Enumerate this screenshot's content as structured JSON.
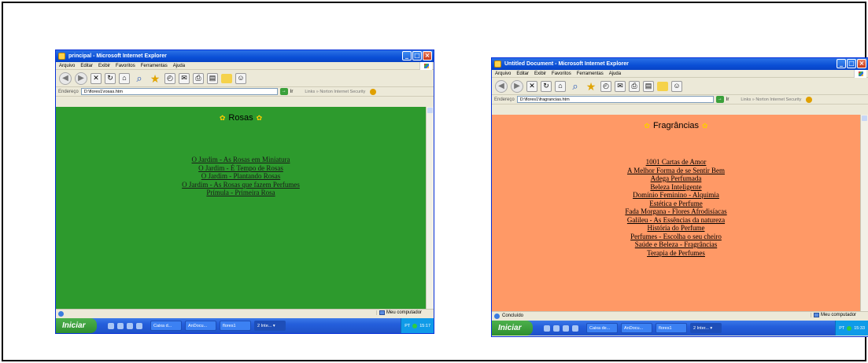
{
  "screens": [
    {
      "title": "principal - Microsoft Internet Explorer",
      "menu": [
        "Arquivo",
        "Editar",
        "Exibir",
        "Favoritos",
        "Ferramentas",
        "Ajuda"
      ],
      "address_label": "Endereço",
      "address": "D:\\flores1\\rosas.htm",
      "go_label": "Ir",
      "address_extra": "Links  »  Norton Internet Security",
      "heading": "Rosas",
      "links": [
        "O Jardim - As Rosas em Miniatura",
        "O Jardim - É Tempo de Rosas",
        "O Jardim - Plantando Rosas",
        "O Jardim - As Rosas que fazem Perfumes",
        "Prímula - Primeira Rosa"
      ],
      "status_left": "",
      "status_zone": "Meu computador",
      "taskbar": {
        "start": "Iniciar",
        "buttons": [
          "Caixa d...",
          "AnDocu...",
          "flores1",
          "2 Inte...  ▾"
        ],
        "clock": "15:17",
        "tray_lang": "PT"
      }
    },
    {
      "title": "Untitled Document - Microsoft Internet Explorer",
      "menu": [
        "Arquivo",
        "Editar",
        "Exibir",
        "Favoritos",
        "Ferramentas",
        "Ajuda"
      ],
      "address_label": "Endereço",
      "address": "D:\\flores1\\fragrancias.htm",
      "go_label": "Ir",
      "address_extra": "Links  »  Norton Internet Security",
      "heading": "Fragrâncias",
      "links": [
        "1001 Cartas de Amor",
        "A Melhor Forma de se Sentir Bem",
        "Adega Perfumada",
        "Beleza Inteligente",
        "Domínio Feminino - Alquimia",
        "Estética e Perfume",
        "Fada Morgana - Flores Afrodisíacas",
        "Galileu - As Essências da natureza",
        "História do Perfume",
        "Perfumes - Escolha o seu cheiro",
        "Saúde e Beleza - Fragrâncias",
        "Terapia de Perfumes"
      ],
      "status_left": "Concluído",
      "status_zone": "Meu computador",
      "taskbar": {
        "start": "Iniciar",
        "buttons": [
          "Caixa de...",
          "AnDocu...",
          "flores1",
          "2 Inter...  ▾"
        ],
        "clock": "15:33",
        "tray_lang": "PT"
      }
    }
  ],
  "colors": {
    "rosas_bg": "#2d9a2d",
    "fragrancias_bg": "#ff9966",
    "xp_blue": "#0a4fd6",
    "start_green": "#2f8f2f"
  }
}
